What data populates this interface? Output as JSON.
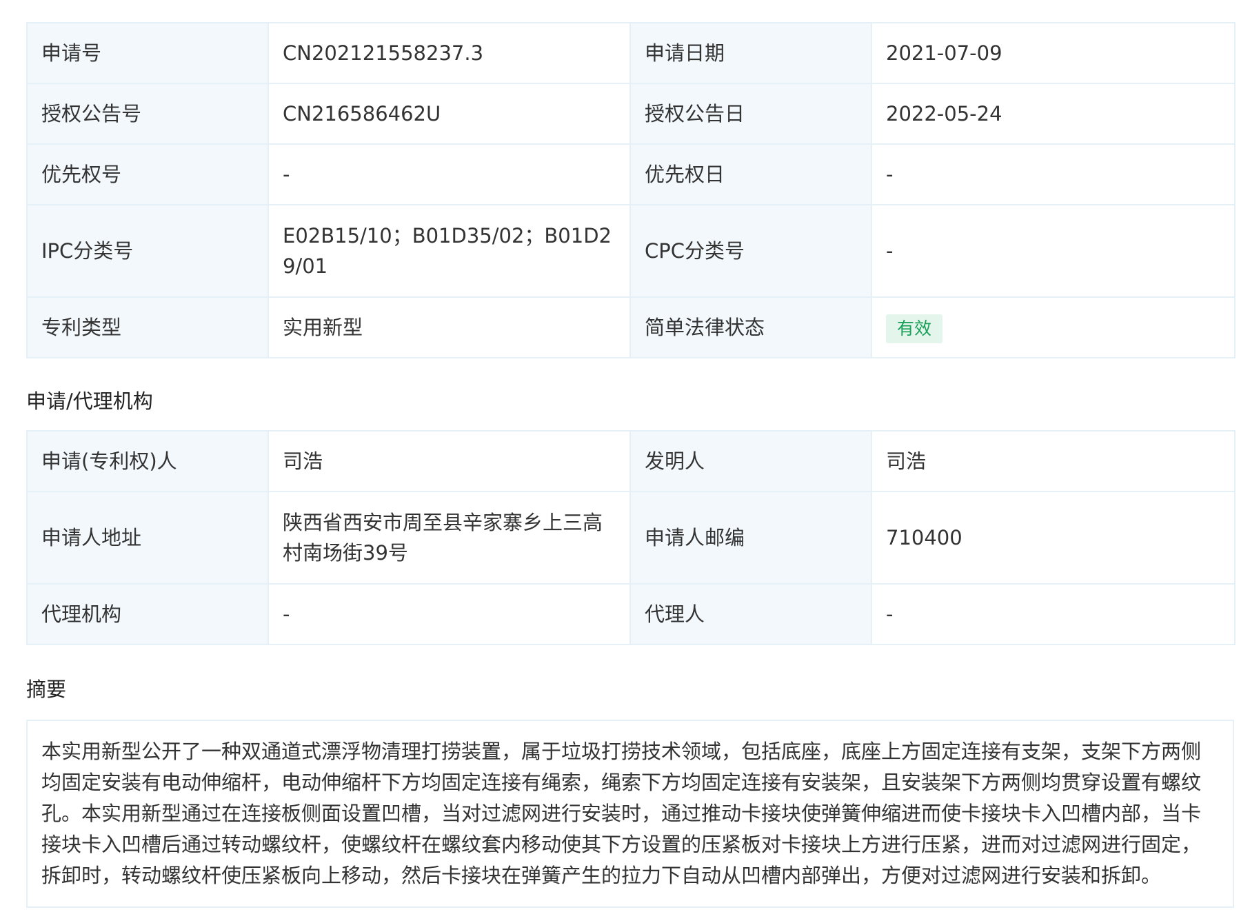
{
  "patent_info": {
    "rows": [
      {
        "label1": "申请号",
        "value1": "CN202121558237.3",
        "label2": "申请日期",
        "value2": "2021-07-09"
      },
      {
        "label1": "授权公告号",
        "value1": "CN216586462U",
        "label2": "授权公告日",
        "value2": "2022-05-24"
      },
      {
        "label1": "优先权号",
        "value1": "-",
        "label2": "优先权日",
        "value2": "-"
      },
      {
        "label1": "IPC分类号",
        "value1": "E02B15/10；B01D35/02；B01D29/01",
        "label2": "CPC分类号",
        "value2": "-"
      },
      {
        "label1": "专利类型",
        "value1": "实用新型",
        "label2": "简单法律状态",
        "value2": "有效"
      }
    ]
  },
  "agency_section": {
    "title": "申请/代理机构",
    "rows": [
      {
        "label1": "申请(专利权)人",
        "value1": "司浩",
        "label2": "发明人",
        "value2": "司浩"
      },
      {
        "label1": "申请人地址",
        "value1": "陕西省西安市周至县辛家寨乡上三高村南场街39号",
        "label2": "申请人邮编",
        "value2": "710400"
      },
      {
        "label1": "代理机构",
        "value1": "-",
        "label2": "代理人",
        "value2": "-"
      }
    ]
  },
  "abstract_section": {
    "title": "摘要",
    "text": "本实用新型公开了一种双通道式漂浮物清理打捞装置，属于垃圾打捞技术领域，包括底座，底座上方固定连接有支架，支架下方两侧均固定安装有电动伸缩杆，电动伸缩杆下方均固定连接有绳索，绳索下方均固定连接有安装架，且安装架下方两侧均贯穿设置有螺纹孔。本实用新型通过在连接板侧面设置凹槽，当对过滤网进行安装时，通过推动卡接块使弹簧伸缩进而使卡接块卡入凹槽内部，当卡接块卡入凹槽后通过转动螺纹杆，使螺纹杆在螺纹套内移动使其下方设置的压紧板对卡接块上方进行压紧，进而对过滤网进行固定，拆卸时，转动螺纹杆使压紧板向上移动，然后卡接块在弹簧产生的拉力下自动从凹槽内部弹出，方便对过滤网进行安装和拆卸。"
  },
  "colors": {
    "label_bg": "#f2f8fc",
    "border": "#e6f0f7",
    "status_badge_bg": "#e4f6ec",
    "status_badge_text": "#18a058"
  }
}
